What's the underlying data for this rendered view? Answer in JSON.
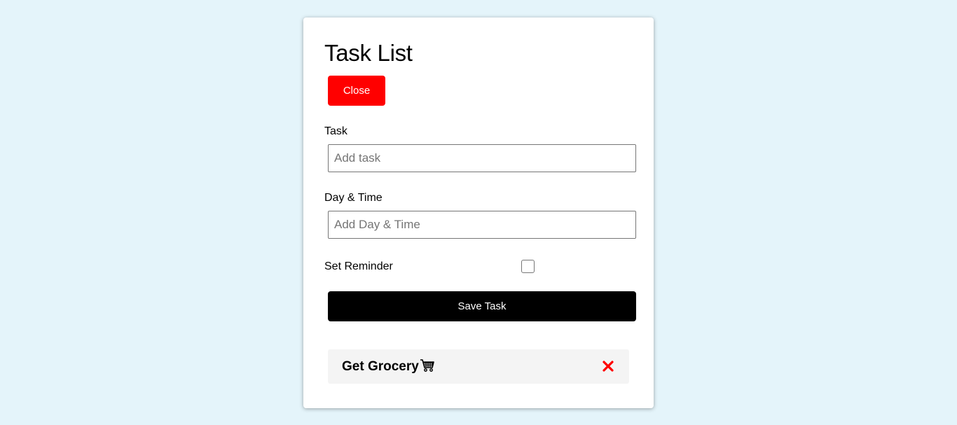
{
  "page": {
    "title": "Task List",
    "background_color": "#e4f4fa"
  },
  "buttons": {
    "close_label": "Close",
    "close_color": "#ff0000",
    "save_label": "Save Task",
    "save_color": "#000000"
  },
  "form": {
    "task_label": "Task",
    "task_placeholder": "Add task",
    "task_value": "",
    "day_label": "Day & Time",
    "day_placeholder": "Add Day & Time",
    "day_value": "",
    "reminder_label": "Set Reminder",
    "reminder_checked": false
  },
  "tasks": [
    {
      "text": "Get Grocery",
      "icon": "shopping-cart-icon",
      "delete_icon": "delete-x-icon",
      "delete_color": "#ff0000"
    }
  ]
}
